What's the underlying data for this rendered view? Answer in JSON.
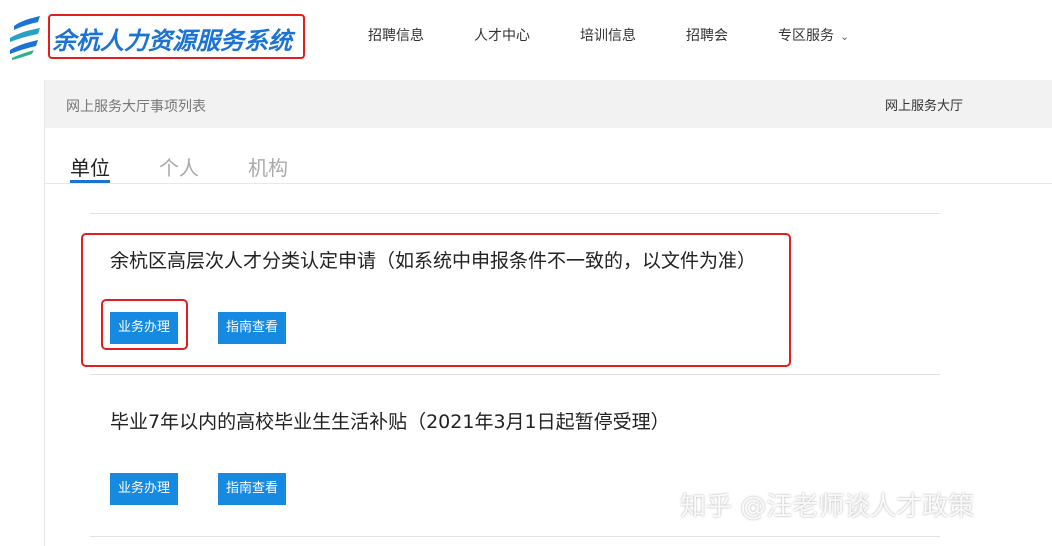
{
  "header": {
    "logo_text": "余杭人力资源服务系统",
    "nav": [
      {
        "label": "招聘信息"
      },
      {
        "label": "人才中心"
      },
      {
        "label": "培训信息"
      },
      {
        "label": "招聘会"
      },
      {
        "label": "专区服务"
      }
    ],
    "dropdown_icon": "chevron-down-icon"
  },
  "breadcrumb": {
    "title": "网上服务大厅事项列表",
    "right_link": "网上服务大厅"
  },
  "tabs": [
    {
      "label": "单位",
      "active": true
    },
    {
      "label": "个人",
      "active": false
    },
    {
      "label": "机构",
      "active": false
    }
  ],
  "services": [
    {
      "title": "余杭区高层次人才分类认定申请（如系统中申报条件不一致的，以文件为准）",
      "handle_label": "业务办理",
      "guide_label": "指南查看"
    },
    {
      "title": "毕业7年以内的高校毕业生生活补贴（2021年3月1日起暂停受理）",
      "handle_label": "业务办理",
      "guide_label": "指南查看"
    }
  ],
  "watermark": "知乎 @汪老师谈人才政策",
  "colors": {
    "accent": "#1b74d4",
    "button": "#1689e0",
    "highlight": "#e02020"
  }
}
